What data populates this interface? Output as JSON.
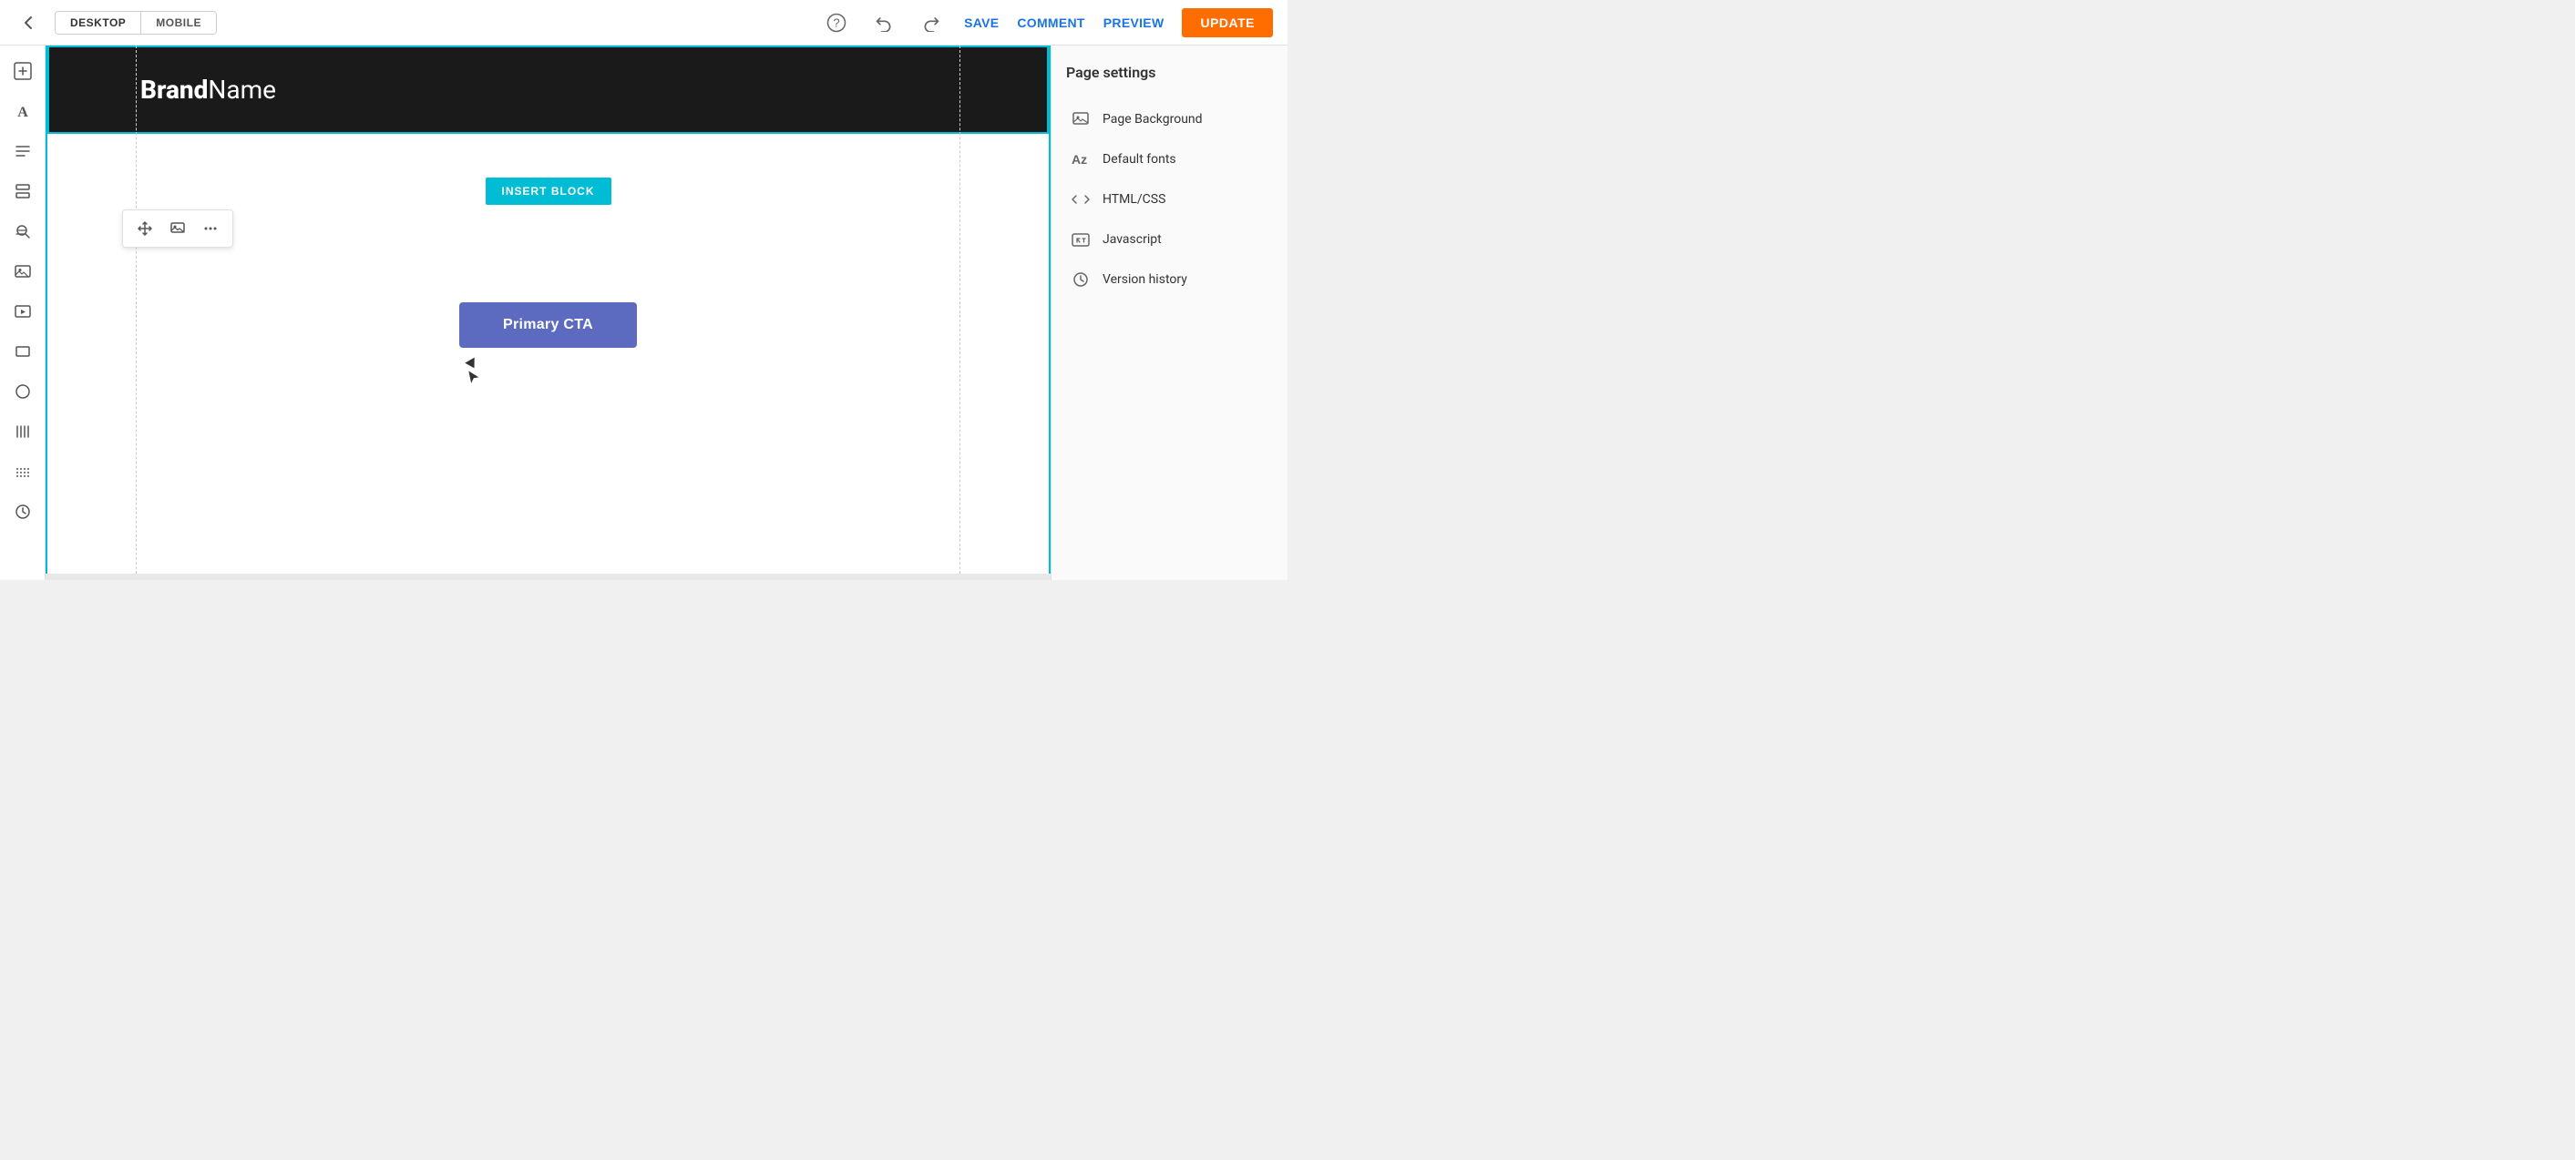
{
  "topbar": {
    "back_icon": "←",
    "view_desktop_label": "DESKTOP",
    "view_mobile_label": "MOBILE",
    "help_icon": "?",
    "undo_icon": "↩",
    "redo_icon": "↪",
    "save_label": "SAVE",
    "comment_label": "COMMENT",
    "preview_label": "PREVIEW",
    "update_label": "UPDATE"
  },
  "left_sidebar": {
    "icons": [
      {
        "name": "add-section-icon",
        "symbol": "+"
      },
      {
        "name": "text-icon",
        "symbol": "A"
      },
      {
        "name": "align-icon",
        "symbol": "≡"
      },
      {
        "name": "layers-icon",
        "symbol": "⊟"
      },
      {
        "name": "search-icon",
        "symbol": "🔍"
      },
      {
        "name": "image-icon",
        "symbol": "🖼"
      },
      {
        "name": "video-icon",
        "symbol": "▶"
      },
      {
        "name": "rectangle-icon",
        "symbol": "☐"
      },
      {
        "name": "circle-icon",
        "symbol": "○"
      },
      {
        "name": "columns-icon",
        "symbol": "⁞"
      },
      {
        "name": "divider-icon",
        "symbol": "⋯"
      },
      {
        "name": "history-icon",
        "symbol": "🕐"
      }
    ]
  },
  "canvas": {
    "hero_brand_text_bold": "Brand",
    "hero_brand_text_normal": "Name",
    "insert_block_label": "INSERT BLOCK",
    "primary_cta_label": "Primary CTA"
  },
  "block_toolbar": {
    "move_icon": "✥",
    "image_icon": "🖼",
    "more_icon": "···"
  },
  "right_sidebar": {
    "title": "Page settings",
    "items": [
      {
        "label": "Page Background",
        "icon_name": "page-background-icon",
        "icon_symbol": "🖼"
      },
      {
        "label": "Default fonts",
        "icon_name": "default-fonts-icon",
        "icon_symbol": "Az"
      },
      {
        "label": "HTML/CSS",
        "icon_name": "html-css-icon",
        "icon_symbol": "<>"
      },
      {
        "label": "Javascript",
        "icon_name": "javascript-icon",
        "icon_symbol": "{}"
      },
      {
        "label": "Version history",
        "icon_name": "version-history-icon",
        "icon_symbol": "🕐"
      }
    ]
  }
}
